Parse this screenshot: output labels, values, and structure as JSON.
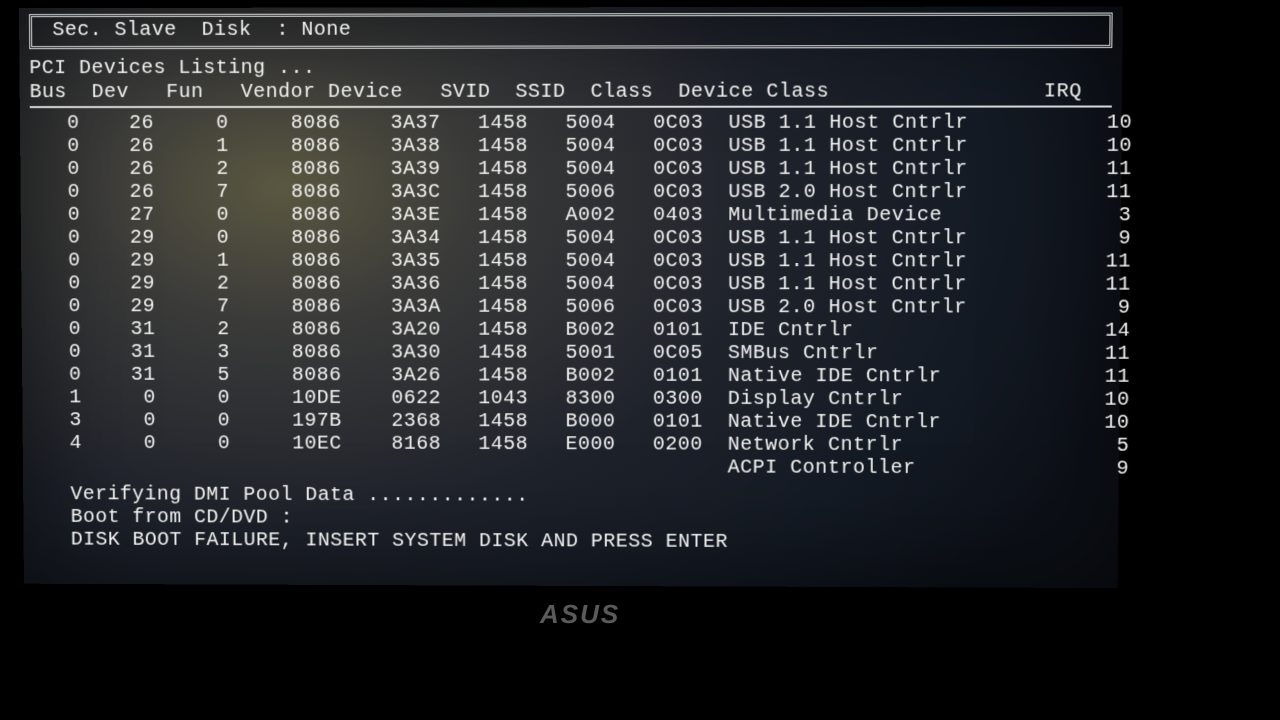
{
  "top_box": {
    "line": " Sec. Slave  Disk  : None"
  },
  "title": "PCI Devices Listing ...",
  "columns": [
    "Bus",
    "Dev",
    "Fun",
    "Vendor",
    "Device",
    "SVID",
    "SSID",
    "Class",
    "Device Class",
    "IRQ"
  ],
  "rows": [
    {
      "bus": "0",
      "dev": "26",
      "fun": "0",
      "vendor": "8086",
      "device": "3A37",
      "svid": "1458",
      "ssid": "5004",
      "cls": "0C03",
      "dclass": "USB 1.1 Host Cntrlr",
      "irq": "10"
    },
    {
      "bus": "0",
      "dev": "26",
      "fun": "1",
      "vendor": "8086",
      "device": "3A38",
      "svid": "1458",
      "ssid": "5004",
      "cls": "0C03",
      "dclass": "USB 1.1 Host Cntrlr",
      "irq": "10"
    },
    {
      "bus": "0",
      "dev": "26",
      "fun": "2",
      "vendor": "8086",
      "device": "3A39",
      "svid": "1458",
      "ssid": "5004",
      "cls": "0C03",
      "dclass": "USB 1.1 Host Cntrlr",
      "irq": "11"
    },
    {
      "bus": "0",
      "dev": "26",
      "fun": "7",
      "vendor": "8086",
      "device": "3A3C",
      "svid": "1458",
      "ssid": "5006",
      "cls": "0C03",
      "dclass": "USB 2.0 Host Cntrlr",
      "irq": "11"
    },
    {
      "bus": "0",
      "dev": "27",
      "fun": "0",
      "vendor": "8086",
      "device": "3A3E",
      "svid": "1458",
      "ssid": "A002",
      "cls": "0403",
      "dclass": "Multimedia Device",
      "irq": "3"
    },
    {
      "bus": "0",
      "dev": "29",
      "fun": "0",
      "vendor": "8086",
      "device": "3A34",
      "svid": "1458",
      "ssid": "5004",
      "cls": "0C03",
      "dclass": "USB 1.1 Host Cntrlr",
      "irq": "9"
    },
    {
      "bus": "0",
      "dev": "29",
      "fun": "1",
      "vendor": "8086",
      "device": "3A35",
      "svid": "1458",
      "ssid": "5004",
      "cls": "0C03",
      "dclass": "USB 1.1 Host Cntrlr",
      "irq": "11"
    },
    {
      "bus": "0",
      "dev": "29",
      "fun": "2",
      "vendor": "8086",
      "device": "3A36",
      "svid": "1458",
      "ssid": "5004",
      "cls": "0C03",
      "dclass": "USB 1.1 Host Cntrlr",
      "irq": "11"
    },
    {
      "bus": "0",
      "dev": "29",
      "fun": "7",
      "vendor": "8086",
      "device": "3A3A",
      "svid": "1458",
      "ssid": "5006",
      "cls": "0C03",
      "dclass": "USB 2.0 Host Cntrlr",
      "irq": "9"
    },
    {
      "bus": "0",
      "dev": "31",
      "fun": "2",
      "vendor": "8086",
      "device": "3A20",
      "svid": "1458",
      "ssid": "B002",
      "cls": "0101",
      "dclass": "IDE Cntrlr",
      "irq": "14"
    },
    {
      "bus": "0",
      "dev": "31",
      "fun": "3",
      "vendor": "8086",
      "device": "3A30",
      "svid": "1458",
      "ssid": "5001",
      "cls": "0C05",
      "dclass": "SMBus Cntrlr",
      "irq": "11"
    },
    {
      "bus": "0",
      "dev": "31",
      "fun": "5",
      "vendor": "8086",
      "device": "3A26",
      "svid": "1458",
      "ssid": "B002",
      "cls": "0101",
      "dclass": "Native IDE Cntrlr",
      "irq": "11"
    },
    {
      "bus": "1",
      "dev": "0",
      "fun": "0",
      "vendor": "10DE",
      "device": "0622",
      "svid": "1043",
      "ssid": "8300",
      "cls": "0300",
      "dclass": "Display Cntrlr",
      "irq": "10"
    },
    {
      "bus": "3",
      "dev": "0",
      "fun": "0",
      "vendor": "197B",
      "device": "2368",
      "svid": "1458",
      "ssid": "B000",
      "cls": "0101",
      "dclass": "Native IDE Cntrlr",
      "irq": "10"
    },
    {
      "bus": "4",
      "dev": "0",
      "fun": "0",
      "vendor": "10EC",
      "device": "8168",
      "svid": "1458",
      "ssid": "E000",
      "cls": "0200",
      "dclass": "Network Cntrlr",
      "irq": "5"
    },
    {
      "bus": "",
      "dev": "",
      "fun": "",
      "vendor": "",
      "device": "",
      "svid": "",
      "ssid": "",
      "cls": "",
      "dclass": "ACPI Controller",
      "irq": "9"
    }
  ],
  "messages": [
    "Verifying DMI Pool Data .............",
    "Boot from CD/DVD :",
    "DISK BOOT FAILURE, INSERT SYSTEM DISK AND PRESS ENTER"
  ],
  "monitor_brand": "ASUS"
}
